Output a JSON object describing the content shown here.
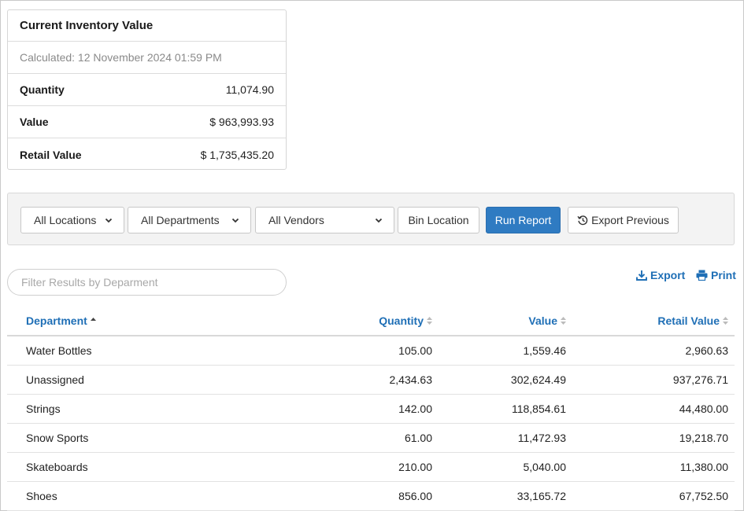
{
  "summary": {
    "title": "Current Inventory Value",
    "calculated": "Calculated: 12 November 2024 01:59 PM",
    "rows": [
      {
        "label": "Quantity",
        "value": "11,074.90"
      },
      {
        "label": "Value",
        "value": "$ 963,993.93"
      },
      {
        "label": "Retail Value",
        "value": "$ 1,735,435.20"
      }
    ]
  },
  "filters": {
    "location": "All Locations",
    "department": "All Departments",
    "vendor": "All Vendors",
    "bin_location": "Bin Location",
    "run_report": "Run Report",
    "export_previous": "Export Previous"
  },
  "search": {
    "placeholder": "Filter Results by Deparment"
  },
  "actions": {
    "export": "Export",
    "print": "Print"
  },
  "table": {
    "columns": [
      "Department",
      "Quantity",
      "Value",
      "Retail Value"
    ],
    "sorted_column": "Department",
    "rows": [
      [
        "Water Bottles",
        "105.00",
        "1,559.46",
        "2,960.63"
      ],
      [
        "Unassigned",
        "2,434.63",
        "302,624.49",
        "937,276.71"
      ],
      [
        "Strings",
        "142.00",
        "118,854.61",
        "44,480.00"
      ],
      [
        "Snow Sports",
        "61.00",
        "11,472.93",
        "19,218.70"
      ],
      [
        "Skateboards",
        "210.00",
        "5,040.00",
        "11,380.00"
      ],
      [
        "Shoes",
        "856.00",
        "33,165.72",
        "67,752.50"
      ]
    ]
  },
  "colors": {
    "accent": "#1f6fb6",
    "primary_button": "#2f7bc2"
  }
}
